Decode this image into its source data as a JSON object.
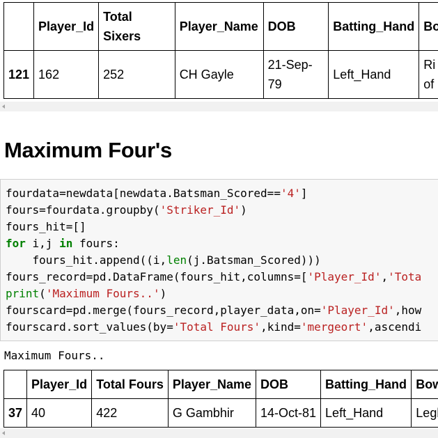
{
  "top_table": {
    "headers": [
      "",
      "Player_Id",
      "Total\nSixers",
      "Player_Name",
      "DOB",
      "Batting_Hand",
      "Bo"
    ],
    "row": [
      "121",
      "162",
      "252",
      "CH Gayle",
      "21-Sep-\n79",
      "Left_Hand",
      "Ri\nof"
    ]
  },
  "heading": "Maximum Four's",
  "code_lines": [
    "fourdata=newdata[newdata.Batsman_Scored=='4']",
    "fours=fourdata.groupby('Striker_Id')",
    "fours_hit=[]",
    "for i,j in fours:",
    "    fours_hit.append((i,len(j.Batsman_Scored)))",
    "fours_record=pd.DataFrame(fours_hit,columns=['Player_Id','Tota",
    "print('Maximum Fours..')",
    "fourscard=pd.merge(fours_record,player_data,on='Player_Id',how",
    "fourscard.sort_values(by='Total Fours',kind='mergeort',ascendi"
  ],
  "output_text": "Maximum Fours..",
  "bottom_table": {
    "headers": [
      "",
      "Player_Id",
      "Total Fours",
      "Player_Name",
      "DOB",
      "Batting_Hand",
      "Bow"
    ],
    "row": [
      "37",
      "40",
      "422",
      "G Gambhir",
      "14-Oct-81",
      "Left_Hand",
      "Legb"
    ]
  }
}
